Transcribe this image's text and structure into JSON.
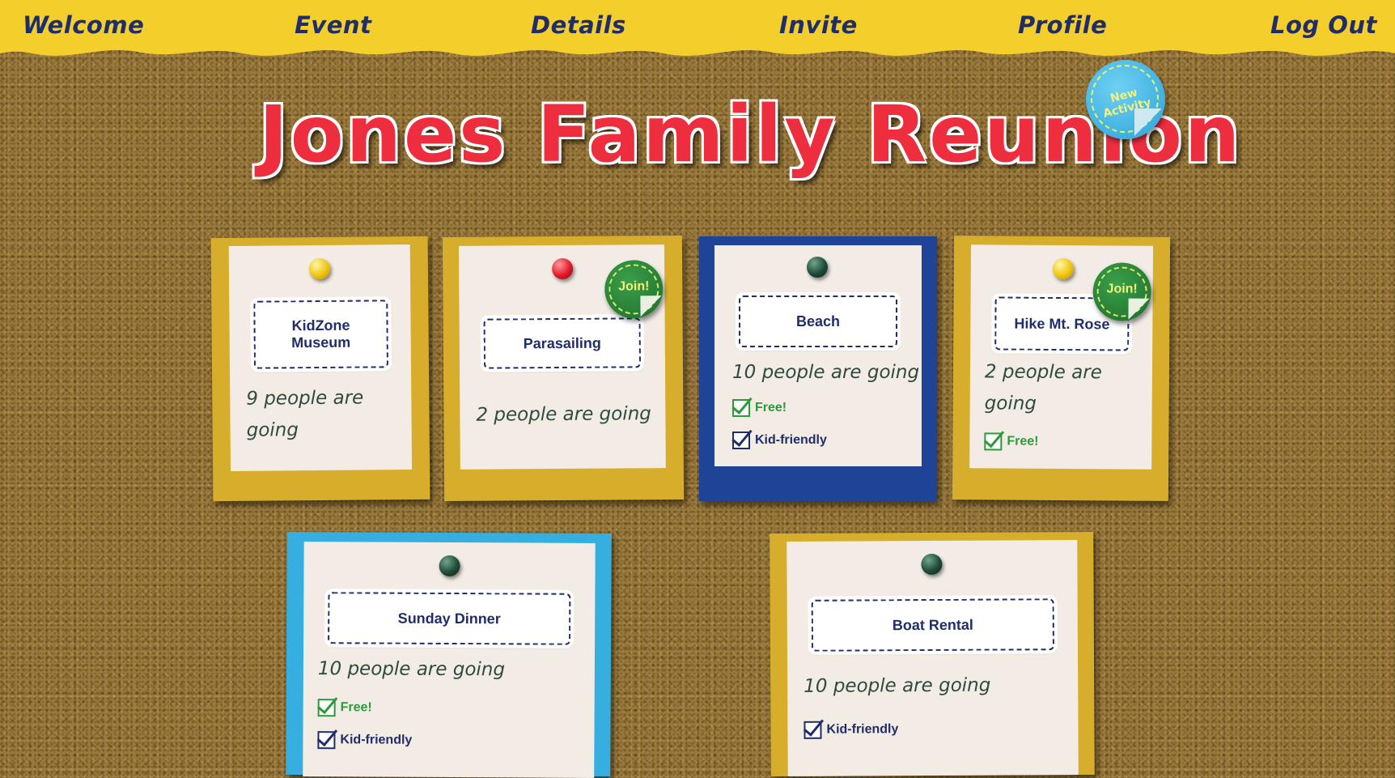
{
  "nav": {
    "items": [
      "Welcome",
      "Event",
      "Details",
      "Invite",
      "Profile",
      "Log Out"
    ]
  },
  "title": "Jones Family Reunion",
  "new_activity_badge": "New Activity",
  "colors": {
    "nav_bg": "#f4cf2c",
    "nav_text": "#1f2d6b",
    "title": "#ee2d3f",
    "frame_gold": "#d6ae2c",
    "frame_navy": "#1f4397",
    "frame_sky": "#36afe0",
    "free": "#2a9a3a",
    "kid": "#1f2d6b"
  },
  "activities": [
    {
      "name_line1": "KidZone",
      "name_line2": "Museum",
      "pin": "yellow",
      "going_line1": "9 people are",
      "going_line2": "going"
    },
    {
      "name": "Parasailing",
      "pin": "red",
      "going": "2 people are going",
      "join": "Join!"
    },
    {
      "name": "Beach",
      "pin": "green",
      "going": "10 people are going",
      "free": "Free!",
      "kid": "Kid-friendly"
    },
    {
      "name": "Hike Mt. Rose",
      "pin": "yellow",
      "going_line1": "2 people are",
      "going_line2": "going",
      "free": "Free!",
      "join": "Join!"
    },
    {
      "name": "Sunday Dinner",
      "pin": "green",
      "going": "10 people are going",
      "free": "Free!",
      "kid": "Kid-friendly"
    },
    {
      "name": "Boat Rental",
      "pin": "green",
      "going": "10 people are going",
      "kid": "Kid-friendly"
    }
  ]
}
